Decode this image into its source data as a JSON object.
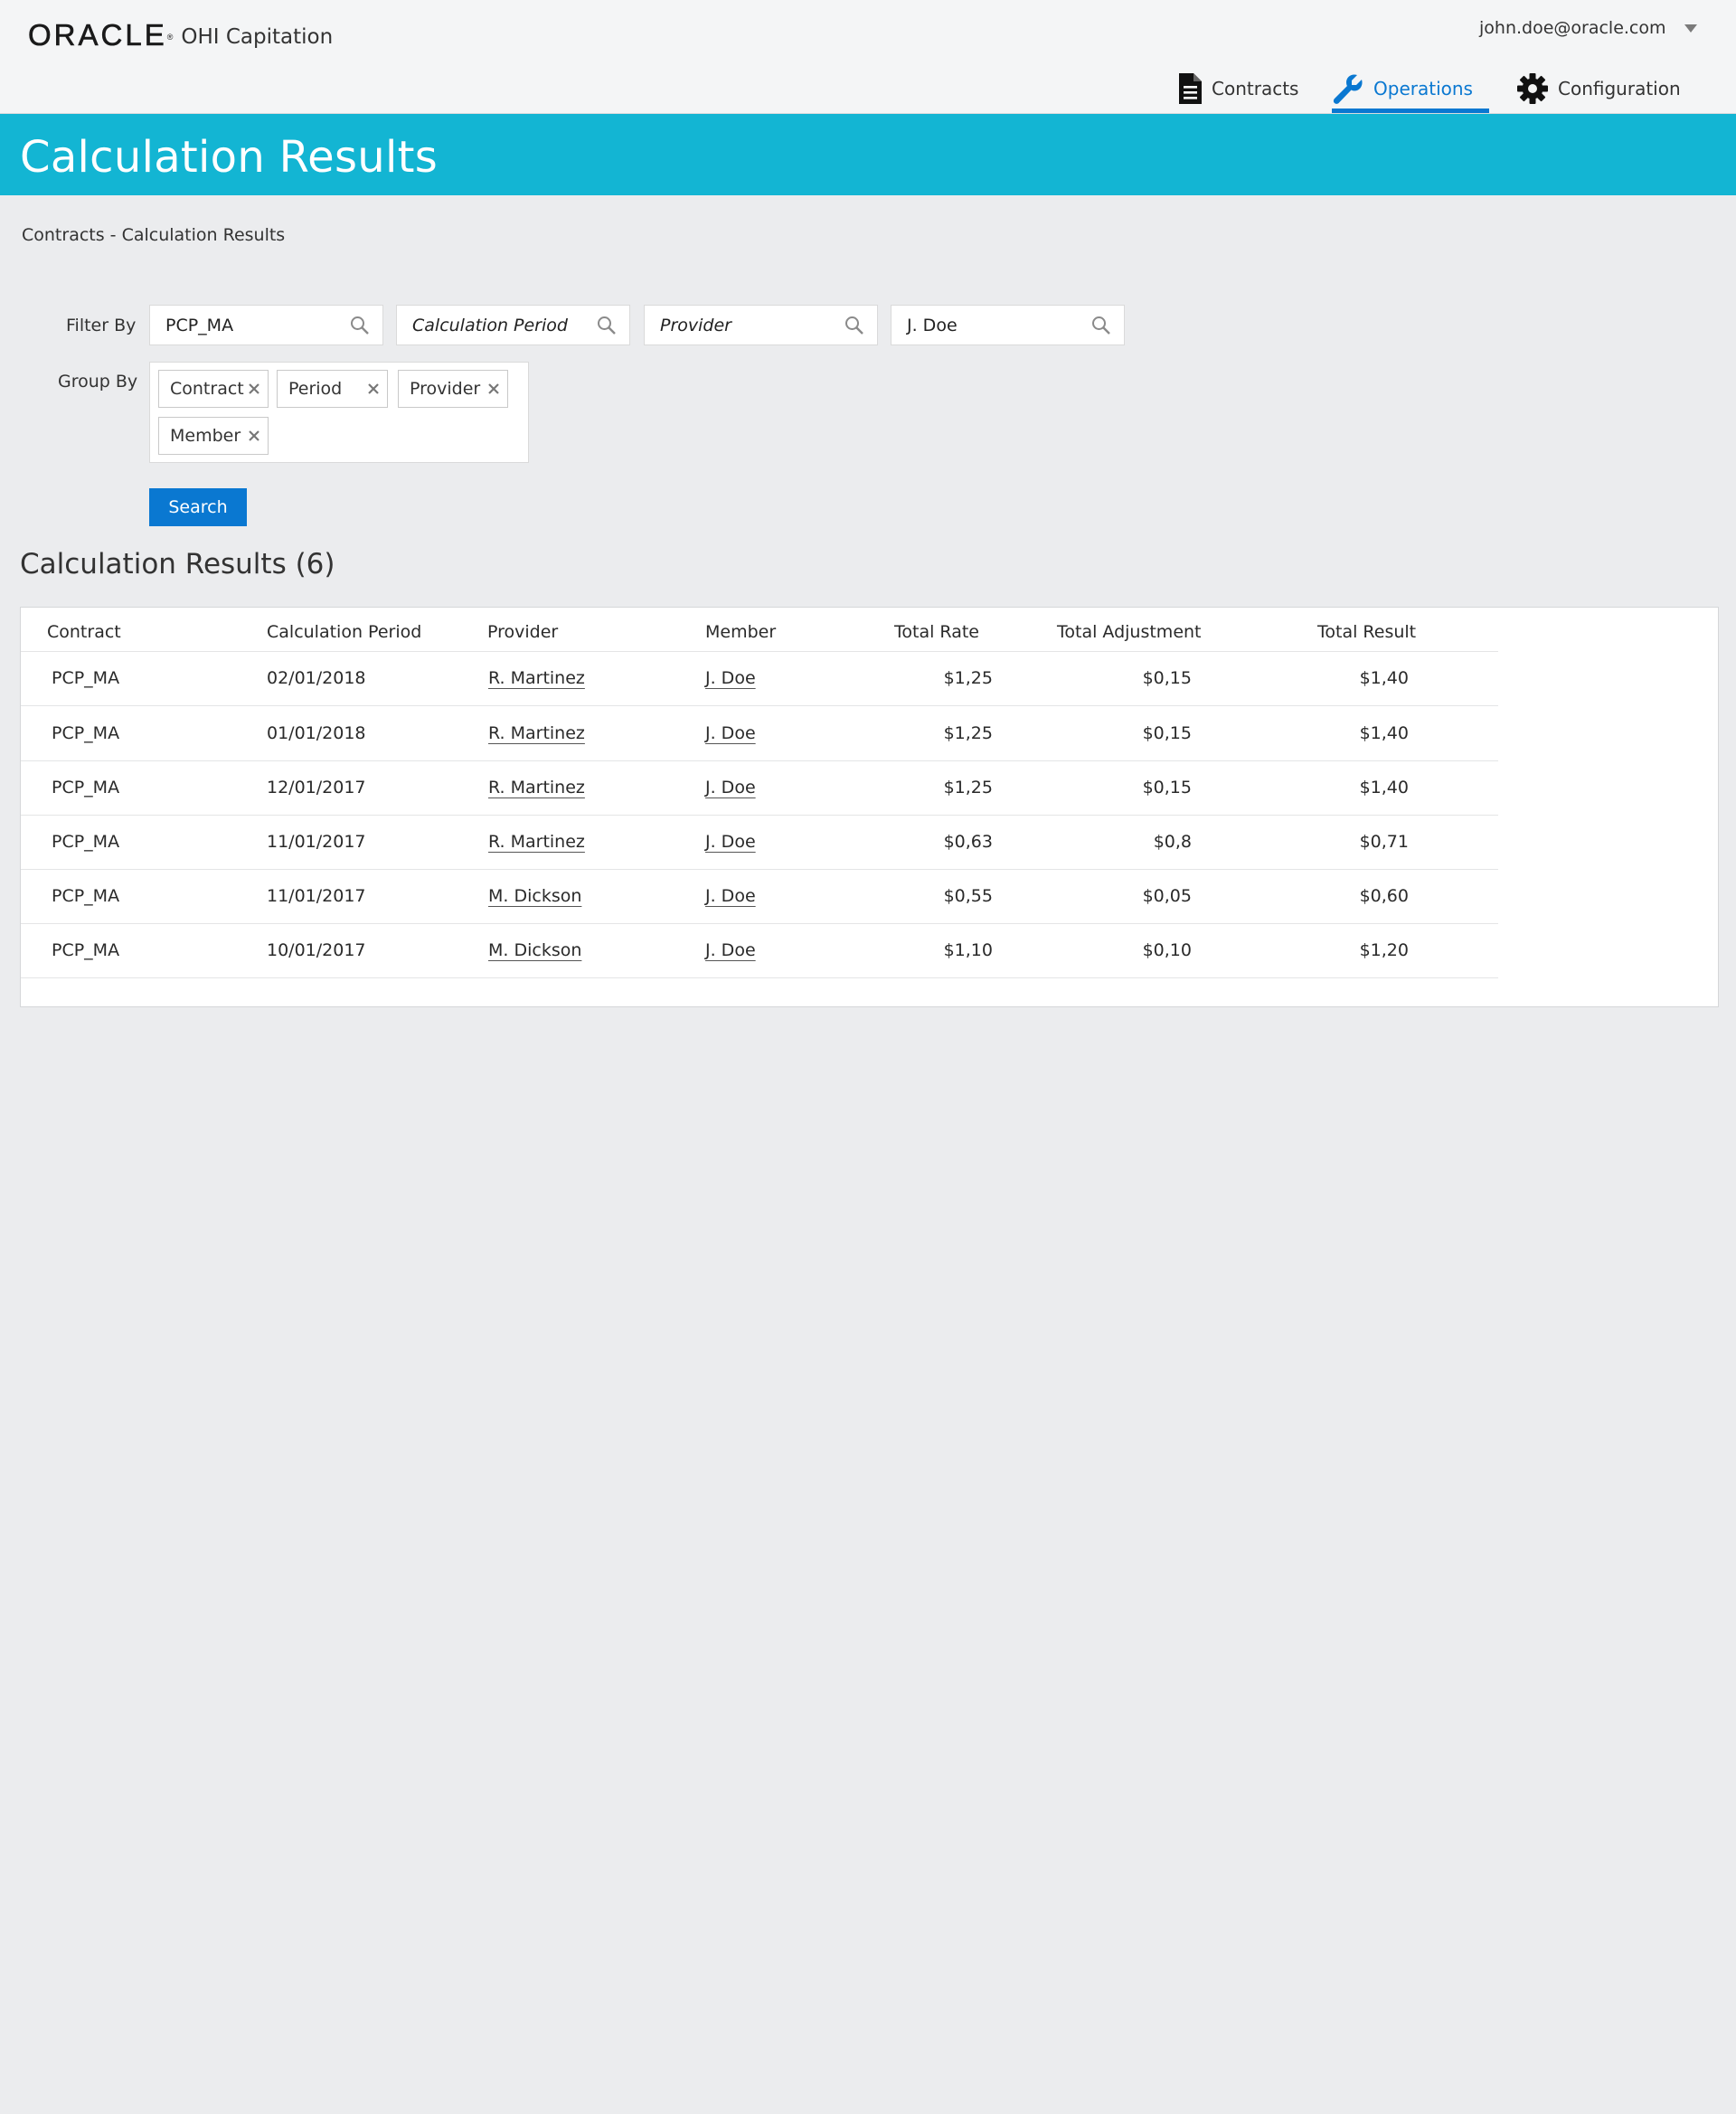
{
  "header": {
    "logo_text": "ORACLE",
    "app_name": "OHI Capitation",
    "user_email": "john.doe@oracle.com",
    "nav": [
      {
        "label": "Contracts",
        "icon": "document-icon",
        "active": false
      },
      {
        "label": "Operations",
        "icon": "wrench-icon",
        "active": true
      },
      {
        "label": "Configuration",
        "icon": "gear-icon",
        "active": false
      }
    ]
  },
  "page": {
    "title": "Calculation Results",
    "breadcrumb": "Contracts - Calculation Results"
  },
  "filters": {
    "filter_by_label": "Filter By",
    "contract": {
      "value": "PCP_MA",
      "placeholder": ""
    },
    "period": {
      "value": "",
      "placeholder": "Calculation Period"
    },
    "provider": {
      "value": "",
      "placeholder": "Provider"
    },
    "member": {
      "value": "J. Doe",
      "placeholder": ""
    },
    "group_by_label": "Group By",
    "group_by_chips": [
      "Contract",
      "Period",
      "Provider",
      "Member"
    ],
    "search_label": "Search"
  },
  "results": {
    "title": "Calculation Results (6)",
    "columns": [
      "Contract",
      "Calculation Period",
      "Provider",
      "Member",
      "Total Rate",
      "Total Adjustment",
      "Total Result"
    ],
    "rows": [
      {
        "contract": "PCP_MA",
        "period": "02/01/2018",
        "provider": "R. Martinez",
        "member": "J. Doe",
        "rate": "$1,25",
        "adjustment": "$0,15",
        "result": "$1,40"
      },
      {
        "contract": "PCP_MA",
        "period": "01/01/2018",
        "provider": "R. Martinez",
        "member": "J. Doe",
        "rate": "$1,25",
        "adjustment": "$0,15",
        "result": "$1,40"
      },
      {
        "contract": "PCP_MA",
        "period": "12/01/2017",
        "provider": "R. Martinez",
        "member": "J. Doe",
        "rate": "$1,25",
        "adjustment": "$0,15",
        "result": "$1,40"
      },
      {
        "contract": "PCP_MA",
        "period": "11/01/2017",
        "provider": "R. Martinez",
        "member": "J. Doe",
        "rate": "$0,63",
        "adjustment": "$0,8",
        "result": "$0,71"
      },
      {
        "contract": "PCP_MA",
        "period": "11/01/2017",
        "provider": "M. Dickson",
        "member": "J. Doe",
        "rate": "$0,55",
        "adjustment": "$0,05",
        "result": "$0,60"
      },
      {
        "contract": "PCP_MA",
        "period": "10/01/2017",
        "provider": "M. Dickson",
        "member": "J. Doe",
        "rate": "$1,10",
        "adjustment": "$0,10",
        "result": "$1,20"
      }
    ]
  },
  "colors": {
    "accent": "#0a78d1",
    "title_band": "#13b5d3",
    "background": "#ebecee"
  }
}
